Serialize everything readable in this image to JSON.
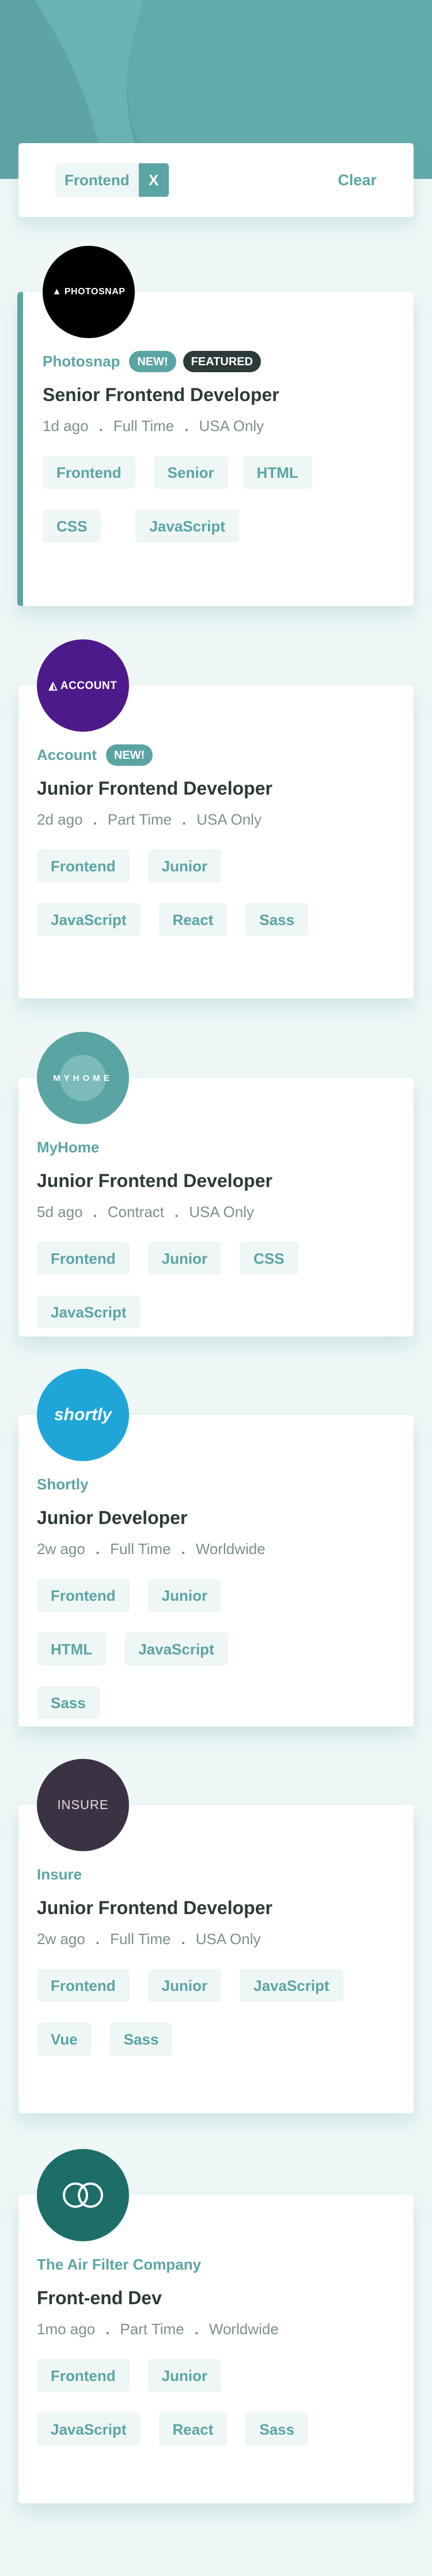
{
  "filter": {
    "chips": [
      {
        "label": "Frontend",
        "remove": "X"
      }
    ],
    "clear_label": "Clear"
  },
  "colors": {
    "primary": "#5ba4a4",
    "header_bg": "#5fa4a4",
    "page_bg": "#eff7f7",
    "tag_bg": "#eef6f6",
    "dark": "#2c3a3a",
    "muted": "#7c8f8f"
  },
  "jobs": [
    {
      "logo_text": "PHOTOSNAP",
      "logo_bg": "#000000",
      "company": "Photosnap",
      "new_label": "NEW!",
      "featured_label": "FEATURED",
      "position": "Senior Frontend Developer",
      "posted": "1d ago",
      "contract": "Full Time",
      "location": "USA Only",
      "tags": [
        "Frontend",
        "Senior",
        "HTML",
        "CSS",
        "JavaScript"
      ]
    },
    {
      "logo_text": "ACCOUNT",
      "logo_bg": "#4c1a8a",
      "company": "Account",
      "new_label": "NEW!",
      "position": "Junior Frontend Developer",
      "posted": "2d ago",
      "contract": "Part Time",
      "location": "USA Only",
      "tags": [
        "Frontend",
        "Junior",
        "JavaScript",
        "React",
        "Sass"
      ]
    },
    {
      "logo_text": "MYHOME",
      "logo_bg": "#5ba4a4",
      "company": "MyHome",
      "position": "Junior Frontend Developer",
      "posted": "5d ago",
      "contract": "Contract",
      "location": "USA Only",
      "tags": [
        "Frontend",
        "Junior",
        "CSS",
        "JavaScript"
      ]
    },
    {
      "logo_text": "shortly",
      "logo_bg": "#1fa5d8",
      "company": "Shortly",
      "position": "Junior Developer",
      "posted": "2w ago",
      "contract": "Full Time",
      "location": "Worldwide",
      "tags": [
        "Frontend",
        "Junior",
        "HTML",
        "JavaScript",
        "Sass"
      ]
    },
    {
      "logo_text": "INSURE",
      "logo_bg": "#3b3344",
      "company": "Insure",
      "position": "Junior Frontend Developer",
      "posted": "2w ago",
      "contract": "Full Time",
      "location": "USA Only",
      "tags": [
        "Frontend",
        "Junior",
        "JavaScript",
        "Vue",
        "Sass"
      ]
    },
    {
      "logo_text": "",
      "logo_bg": "#1d6d68",
      "company": "The Air Filter Company",
      "position": "Front-end Dev",
      "posted": "1mo ago",
      "contract": "Part Time",
      "location": "Worldwide",
      "tags": [
        "Frontend",
        "Junior",
        "JavaScript",
        "React",
        "Sass"
      ]
    }
  ]
}
